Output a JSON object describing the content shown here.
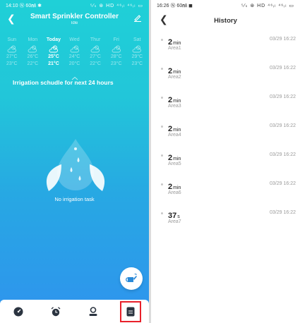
{
  "left": {
    "status": {
      "time": "14:10",
      "icons_left": "Ⓝ 60㎃ ✱",
      "icons_right": "⁵⁄ₛ ⊛ HD ⁴⁶ᵢₗ ⁴⁶ᵢₗ ▭"
    },
    "header": {
      "title": "Smart Sprinkler Controller",
      "subtitle": "Idle"
    },
    "weather": [
      {
        "day": "Sun",
        "high": "27°C",
        "low": "23°C",
        "today": false
      },
      {
        "day": "Mon",
        "high": "26°C",
        "low": "22°C",
        "today": false
      },
      {
        "day": "Today",
        "high": "25°C",
        "low": "21°C",
        "today": true
      },
      {
        "day": "Wed",
        "high": "24°C",
        "low": "20°C",
        "today": false
      },
      {
        "day": "Thur",
        "high": "27°C",
        "low": "22°C",
        "today": false
      },
      {
        "day": "Fri",
        "high": "28°C",
        "low": "23°C",
        "today": false
      },
      {
        "day": "Sat",
        "high": "29°C",
        "low": "23°C",
        "today": false
      }
    ],
    "schedule_title": "Irrigation schudle for next 24 hours",
    "empty_text": "No irrigation task",
    "nav": [
      {
        "name": "nav-home",
        "icon": "gauge-icon"
      },
      {
        "name": "nav-timer",
        "icon": "alarm-clock-icon"
      },
      {
        "name": "nav-profile",
        "icon": "user-icon"
      },
      {
        "name": "nav-history",
        "icon": "document-icon",
        "active": true
      }
    ],
    "colors": {
      "gradient_top": "#1fd0d7",
      "gradient_bottom": "#2f93ee",
      "highlight": "#e8202a"
    }
  },
  "right": {
    "status": {
      "time": "16:26",
      "icons_left": "Ⓝ 60㎃ ◼",
      "icons_right": "⁵⁄ₛ ⊛ HD ⁴⁶ᵢₗ ⁴⁶ᵢₗ ▭"
    },
    "title": "History",
    "items": [
      {
        "num": "2",
        "unit": "min",
        "area": "Area1",
        "time": "03/29 16:22"
      },
      {
        "num": "2",
        "unit": "min",
        "area": "Area2",
        "time": "03/29 16:22"
      },
      {
        "num": "2",
        "unit": "min",
        "area": "Area3",
        "time": "03/29 16:22"
      },
      {
        "num": "2",
        "unit": "min",
        "area": "Area4",
        "time": "03/29 16:22"
      },
      {
        "num": "2",
        "unit": "min",
        "area": "Area5",
        "time": "03/29 16:22"
      },
      {
        "num": "2",
        "unit": "min",
        "area": "Area6",
        "time": "03/29 16:22"
      },
      {
        "num": "37",
        "unit": "s",
        "area": "Area7",
        "time": "03/29 16:22"
      }
    ]
  }
}
